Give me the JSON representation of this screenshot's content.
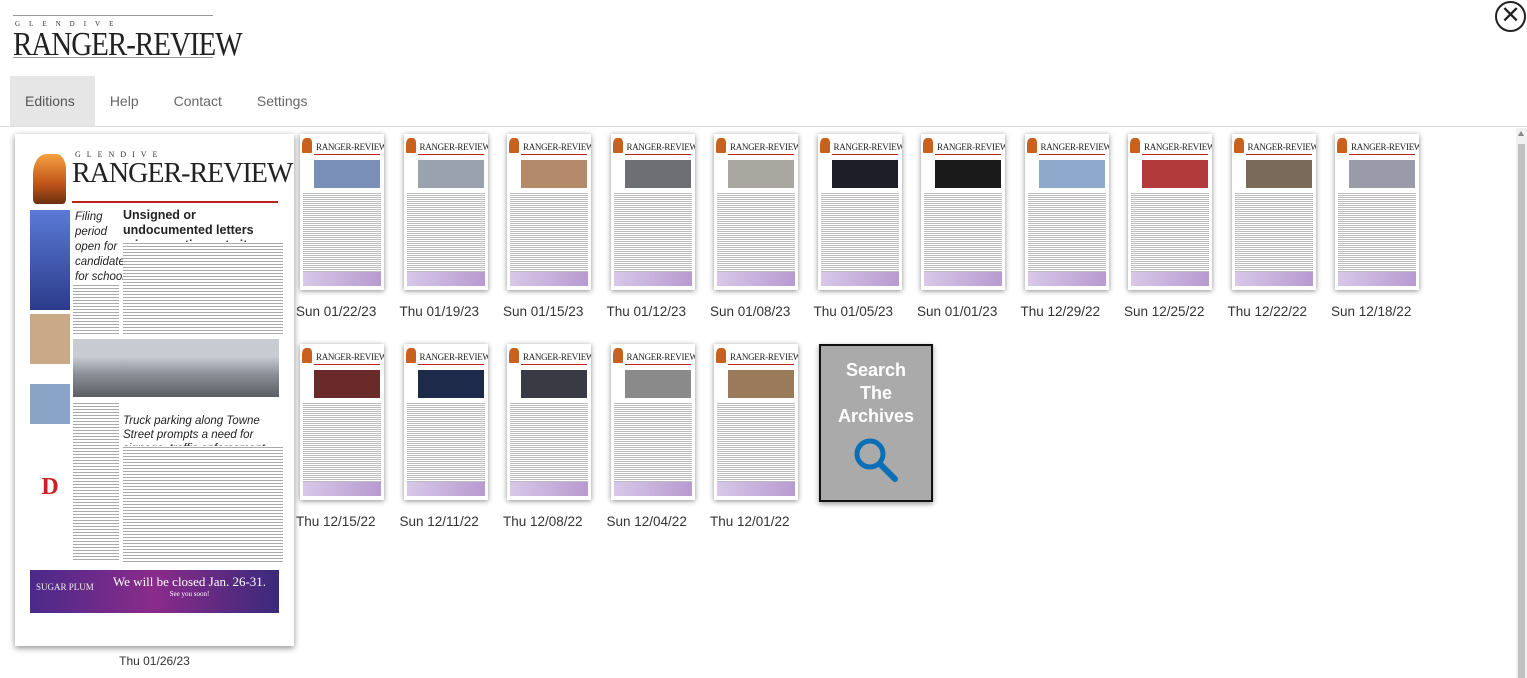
{
  "header": {
    "logo_small": "GLENDIVE",
    "logo_big": "RANGER-REVIEW",
    "close_icon": "close-circle-icon"
  },
  "nav": {
    "tabs": [
      {
        "label": "Editions",
        "active": true
      },
      {
        "label": "Help"
      },
      {
        "label": "Contact"
      },
      {
        "label": "Settings"
      }
    ]
  },
  "featured": {
    "date": "Thu 01/26/23",
    "masthead_small": "GLENDIVE",
    "masthead": "RANGER-REVIEW",
    "side_headline": "Filing period open for candidates for school and district boards",
    "lead_headline": "Unsigned or undocumented letters raise questions at city meeting",
    "second_headline": "Truck parking along Towne Street prompts a need for signage, traffic enforcement",
    "ad_brand": "SUGAR PLUM",
    "ad_line1": "We will be closed Jan. 26-31.",
    "ad_line2": "See you soon!"
  },
  "editions": [
    {
      "date": "Sun 01/22/23",
      "photo": "#7a8fb8"
    },
    {
      "date": "Thu 01/19/23",
      "photo": "#9aa2ad"
    },
    {
      "date": "Sun 01/15/23",
      "photo": "#b48b6a"
    },
    {
      "date": "Thu 01/12/23",
      "photo": "#6d6f73"
    },
    {
      "date": "Sun 01/08/23",
      "photo": "#a8a8a0"
    },
    {
      "date": "Thu 01/05/23",
      "photo": "#1e1e28"
    },
    {
      "date": "Sun 01/01/23",
      "photo": "#1a1a1a"
    },
    {
      "date": "Thu 12/29/22",
      "photo": "#8fa9cc"
    },
    {
      "date": "Sun 12/25/22",
      "photo": "#b33a3a"
    },
    {
      "date": "Thu 12/22/22",
      "photo": "#7a6a5a"
    },
    {
      "date": "Sun 12/18/22",
      "photo": "#9a9aa8"
    },
    {
      "date": "Thu 12/15/22",
      "photo": "#6a2a2a"
    },
    {
      "date": "Sun 12/11/22",
      "photo": "#1e2a4a"
    },
    {
      "date": "Thu 12/08/22",
      "photo": "#3a3a44"
    },
    {
      "date": "Sun 12/04/22",
      "photo": "#8a8a8a"
    },
    {
      "date": "Thu 12/01/22",
      "photo": "#9a7a5a"
    }
  ],
  "search_archives": {
    "line1": "Search",
    "line2": "The",
    "line3": "Archives",
    "icon": "magnifier-icon",
    "icon_color": "#0a6fb4"
  }
}
